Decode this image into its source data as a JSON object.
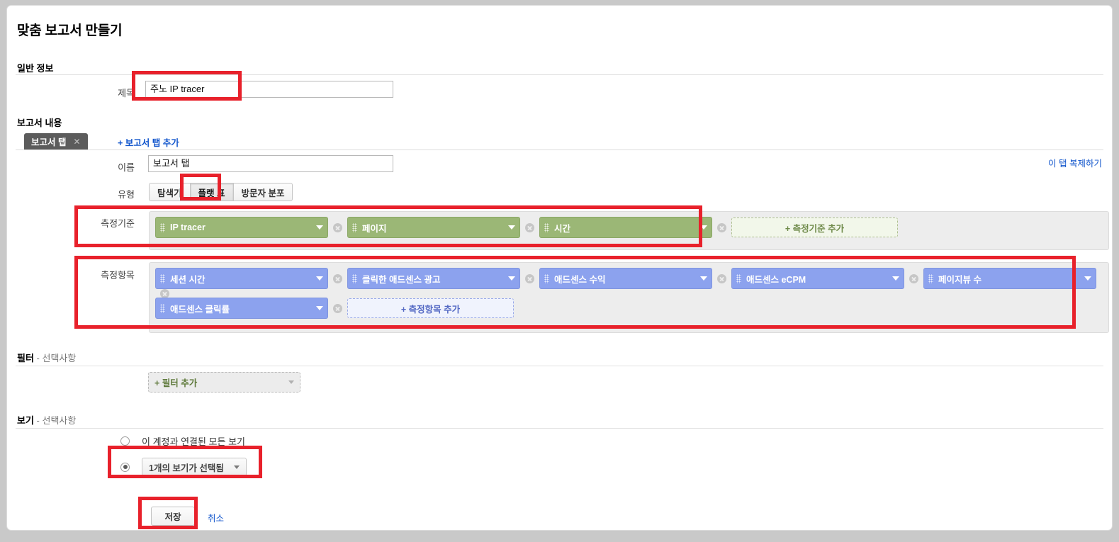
{
  "page": {
    "title": "맞춤 보고서 만들기"
  },
  "general": {
    "heading": "일반 정보",
    "title_label": "제목",
    "title_value": "주노 IP tracer"
  },
  "content": {
    "heading": "보고서 내용",
    "tab_chip_label": "보고서 탭",
    "tab_chip_close": "✕",
    "add_tab_label": "+ 보고서 탭 추가",
    "duplicate_tab_label": "이 탭 복제하기",
    "name_label": "이름",
    "name_value": "보고서 탭",
    "type_label": "유형",
    "types": [
      {
        "label": "탐색기",
        "active": false
      },
      {
        "label": "플랫 표",
        "active": true
      },
      {
        "label": "방문자 분포",
        "active": false
      }
    ]
  },
  "dimensions": {
    "label": "측정기준",
    "chips": [
      {
        "name": "IP tracer"
      },
      {
        "name": "페이지"
      },
      {
        "name": "시간"
      }
    ],
    "add_label": "+ 측정기준 추가",
    "color": "#9bb776"
  },
  "metrics": {
    "label": "측정항목",
    "chips": [
      {
        "name": "세션 시간"
      },
      {
        "name": "클릭한 애드센스 광고"
      },
      {
        "name": "애드센스 수익"
      },
      {
        "name": "애드센스 eCPM"
      },
      {
        "name": "페이지뷰 수"
      },
      {
        "name": "애드센스 클릭률"
      }
    ],
    "add_label": "+ 측정항목 추가",
    "color": "#8ca2ee"
  },
  "filters": {
    "heading": "필터",
    "optional": "- 선택사항",
    "add_label": "+ 필터 추가"
  },
  "views": {
    "heading": "보기",
    "optional": "- 선택사항",
    "option_all": "이 계정과 연결된 모든 보기",
    "option_selected_value": "1개의 보기가 선택됨"
  },
  "actions": {
    "save_label": "저장",
    "cancel_label": "취소"
  },
  "annotations": {
    "accent_color": "#e8212b"
  }
}
